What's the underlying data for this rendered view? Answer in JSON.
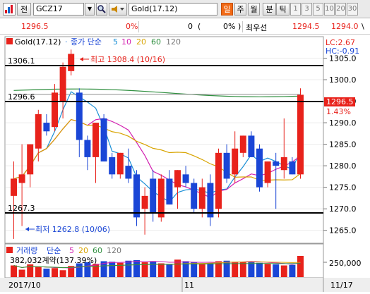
{
  "toolbar": {
    "order_button": "전",
    "symbol": "GCZ17",
    "product_name": "Gold(17.12)",
    "periods": [
      "일",
      "주",
      "월",
      "분",
      "틱"
    ],
    "active_period": "일",
    "minute_units": [
      "1",
      "3",
      "5",
      "10",
      "20",
      "30"
    ]
  },
  "quote": {
    "price": "1296.5",
    "change_pct": "0%",
    "volume_a": "0",
    "paren_open": "(",
    "volume_pct": "0%",
    "paren_close": ")",
    "ask_label": "최우선",
    "ask_price": "1294.5",
    "bid_price": "1294.0",
    "trail": "\\"
  },
  "price_panel": {
    "legend_title": "Gold(17.12)",
    "ma_label": "종가 단순",
    "ma_periods": [
      "5",
      "10",
      "20",
      "60",
      "120"
    ],
    "lc": "LC:2.67",
    "hc": "HC:-0.91",
    "ref_high": "1306.1",
    "ref_mid": "1296.6",
    "ref_low": "1267.3",
    "high_note": "최고 1308.4 (10/16)",
    "low_note": "최저 1262.8 (10/06)",
    "current_price": "1296.5",
    "current_pct": "1.43%",
    "y_ticks": [
      "1305.0",
      "1300.0",
      "1295.0",
      "1290.0",
      "1285.0",
      "1280.0",
      "1275.0",
      "1270.0",
      "1265.0"
    ]
  },
  "volume_panel": {
    "label": "거래량",
    "ma_label": "단순",
    "ma_periods": [
      "5",
      "20",
      "60",
      "120"
    ],
    "value_note": "382,032계약(137.39%)",
    "y_tick": "250,000"
  },
  "x_axis": {
    "labels": [
      "2017/10",
      "11",
      "11/17"
    ]
  },
  "colors": {
    "up": "#e8221b",
    "down": "#1a46d6",
    "ma5": "#1a8fd6",
    "ma10": "#d21fb0",
    "ma20": "#d8a400",
    "ma60": "#2f8f3f",
    "ma120": "#9a9a9a"
  },
  "chart_data": {
    "type": "candlestick",
    "ylim": [
      1262,
      1310
    ],
    "candles": [
      {
        "o": 1273,
        "h": 1281,
        "l": 1263,
        "c": 1277
      },
      {
        "o": 1276,
        "h": 1285,
        "l": 1266,
        "c": 1278
      },
      {
        "o": 1278,
        "h": 1285,
        "l": 1275,
        "c": 1285
      },
      {
        "o": 1284,
        "h": 1293,
        "l": 1281,
        "c": 1292
      },
      {
        "o": 1290,
        "h": 1292,
        "l": 1287,
        "c": 1288
      },
      {
        "o": 1289,
        "h": 1299,
        "l": 1288,
        "c": 1297
      },
      {
        "o": 1295,
        "h": 1304,
        "l": 1291,
        "c": 1303
      },
      {
        "o": 1302,
        "h": 1307,
        "l": 1301,
        "c": 1306
      },
      {
        "o": 1297,
        "h": 1298,
        "l": 1282,
        "c": 1286
      },
      {
        "o": 1286,
        "h": 1287,
        "l": 1279,
        "c": 1282
      },
      {
        "o": 1282,
        "h": 1290,
        "l": 1276,
        "c": 1290
      },
      {
        "o": 1291,
        "h": 1292,
        "l": 1281,
        "c": 1281
      },
      {
        "o": 1282,
        "h": 1283,
        "l": 1277,
        "c": 1278
      },
      {
        "o": 1278,
        "h": 1283,
        "l": 1277,
        "c": 1283
      },
      {
        "o": 1280,
        "h": 1284,
        "l": 1276,
        "c": 1277
      },
      {
        "o": 1278,
        "h": 1279,
        "l": 1266,
        "c": 1268
      },
      {
        "o": 1270,
        "h": 1275,
        "l": 1264,
        "c": 1273
      },
      {
        "o": 1277,
        "h": 1279,
        "l": 1267,
        "c": 1269
      },
      {
        "o": 1268,
        "h": 1278,
        "l": 1267,
        "c": 1277
      },
      {
        "o": 1277,
        "h": 1279,
        "l": 1271,
        "c": 1271
      },
      {
        "o": 1275,
        "h": 1279,
        "l": 1270,
        "c": 1279
      },
      {
        "o": 1278,
        "h": 1280,
        "l": 1275,
        "c": 1276
      },
      {
        "o": 1276,
        "h": 1277,
        "l": 1269,
        "c": 1270
      },
      {
        "o": 1270,
        "h": 1277,
        "l": 1268,
        "c": 1275
      },
      {
        "o": 1276,
        "h": 1278,
        "l": 1266,
        "c": 1268
      },
      {
        "o": 1270,
        "h": 1284,
        "l": 1268,
        "c": 1283
      },
      {
        "o": 1283,
        "h": 1285,
        "l": 1276,
        "c": 1277
      },
      {
        "o": 1278,
        "h": 1288,
        "l": 1276,
        "c": 1284
      },
      {
        "o": 1283,
        "h": 1287,
        "l": 1282,
        "c": 1287
      },
      {
        "o": 1287,
        "h": 1288,
        "l": 1282,
        "c": 1282
      },
      {
        "o": 1284,
        "h": 1285,
        "l": 1274,
        "c": 1275
      },
      {
        "o": 1276,
        "h": 1281,
        "l": 1275,
        "c": 1281
      },
      {
        "o": 1281,
        "h": 1283,
        "l": 1270,
        "c": 1280
      },
      {
        "o": 1279,
        "h": 1291,
        "l": 1277,
        "c": 1282
      },
      {
        "o": 1281,
        "h": 1282,
        "l": 1278,
        "c": 1278
      },
      {
        "o": 1278,
        "h": 1298,
        "l": 1277,
        "c": 1296.5
      }
    ],
    "volume": [
      110,
      70,
      120,
      95,
      80,
      85,
      65,
      105,
      130,
      140,
      125,
      150,
      145,
      135,
      155,
      160,
      140,
      150,
      130,
      120,
      165,
      150,
      140,
      120,
      130,
      150,
      155,
      145,
      140,
      150,
      135,
      125,
      120,
      110,
      115,
      200
    ]
  }
}
